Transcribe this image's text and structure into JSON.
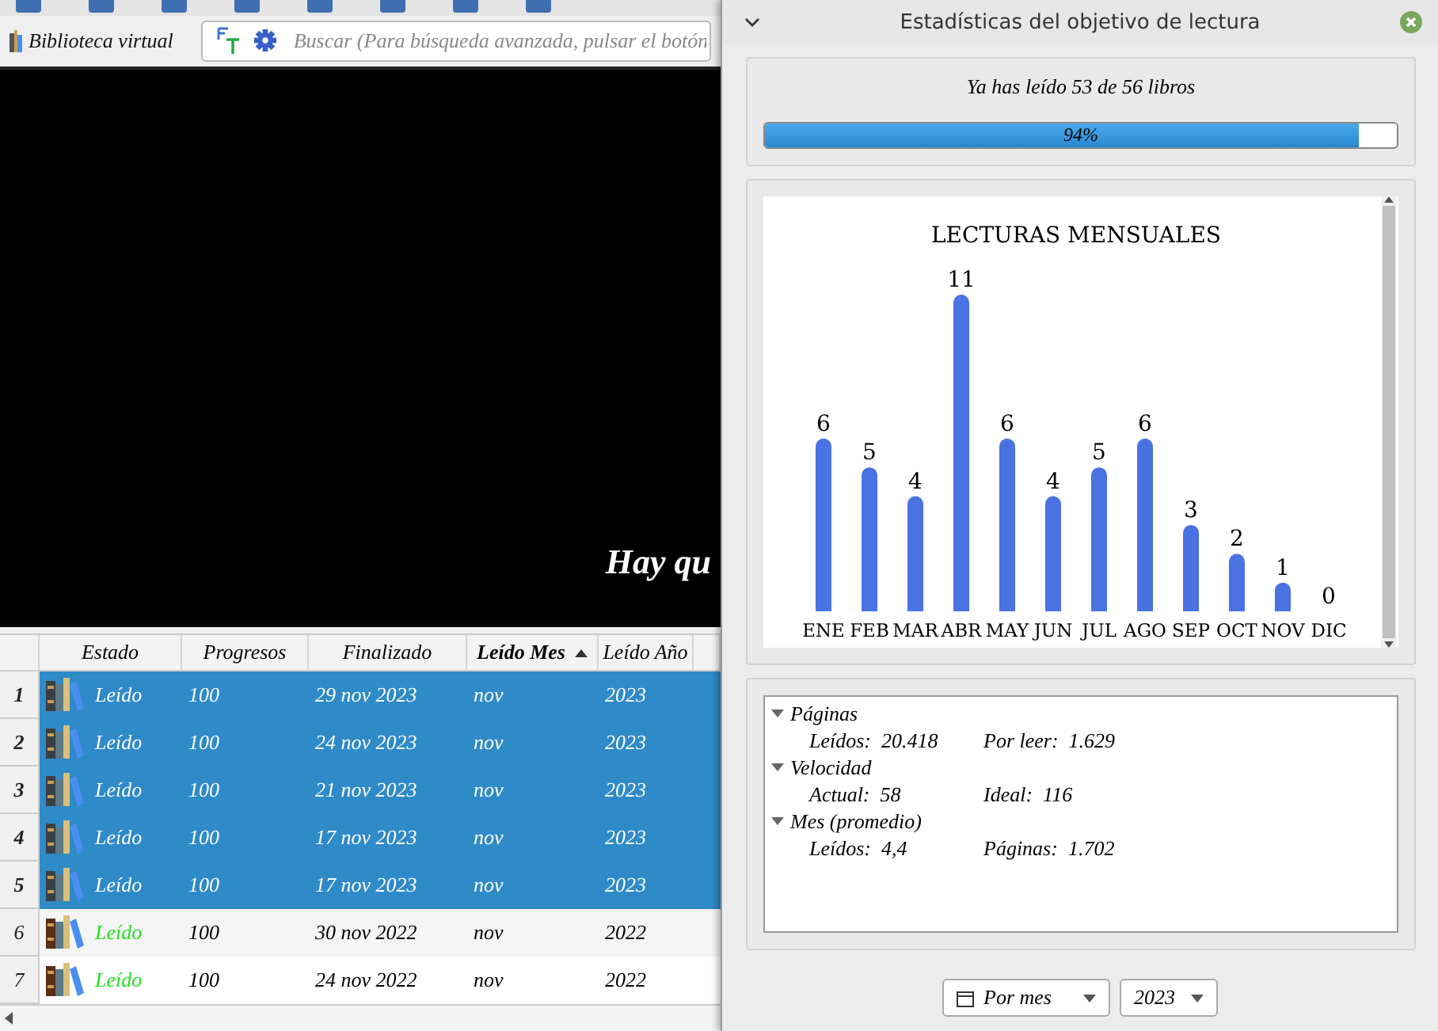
{
  "toolbar": {
    "library_button": "Biblioteca virtual",
    "search": {
      "placeholder": "Buscar (Para búsqueda avanzada, pulsar el botón"
    }
  },
  "cover": {
    "text": "Hay qu"
  },
  "table": {
    "columns": [
      {
        "label": "Estado",
        "sorted": false
      },
      {
        "label": "Progresos",
        "sorted": false
      },
      {
        "label": "Finalizado",
        "sorted": false
      },
      {
        "label": "Leído Mes",
        "sorted": true
      },
      {
        "label": "Leído Año",
        "sorted": false
      }
    ],
    "rows": [
      {
        "number": "1",
        "status": "Leído",
        "progress": "100",
        "finished": "29 nov 2023",
        "month": "nov",
        "year": "2023",
        "selected": true
      },
      {
        "number": "2",
        "status": "Leído",
        "progress": "100",
        "finished": "24 nov 2023",
        "month": "nov",
        "year": "2023",
        "selected": true
      },
      {
        "number": "3",
        "status": "Leído",
        "progress": "100",
        "finished": "21 nov 2023",
        "month": "nov",
        "year": "2023",
        "selected": true
      },
      {
        "number": "4",
        "status": "Leído",
        "progress": "100",
        "finished": "17 nov 2023",
        "month": "nov",
        "year": "2023",
        "selected": true
      },
      {
        "number": "5",
        "status": "Leído",
        "progress": "100",
        "finished": "17 nov 2023",
        "month": "nov",
        "year": "2023",
        "selected": true
      },
      {
        "number": "6",
        "status": "Leído",
        "progress": "100",
        "finished": "30 nov 2022",
        "month": "nov",
        "year": "2022",
        "selected": false
      },
      {
        "number": "7",
        "status": "Leído",
        "progress": "100",
        "finished": "24 nov 2022",
        "month": "nov",
        "year": "2022",
        "selected": false
      }
    ]
  },
  "dialog": {
    "title": "Estadísticas del objetivo de lectura",
    "goal": {
      "text": "Ya has leído 53 de 56 libros",
      "level": 0.94,
      "reading": "94%"
    },
    "chart_data": {
      "type": "bar",
      "title": "LECTURAS MENSUALES",
      "categories": [
        "ENE",
        "FEB",
        "MAR",
        "ABR",
        "MAY",
        "JUN",
        "JUL",
        "AGO",
        "SEP",
        "OCT",
        "NOV",
        "DIC"
      ],
      "values": [
        6,
        5,
        4,
        11,
        6,
        4,
        5,
        6,
        3,
        2,
        1,
        0
      ],
      "data_labels": true
    },
    "stats": [
      {
        "label": "Páginas",
        "expanded": true,
        "children": [
          {
            "label": "Leídos:",
            "value": "20.418"
          },
          {
            "label": "Por leer:",
            "value": "1.629"
          }
        ]
      },
      {
        "label": "Velocidad",
        "expanded": true,
        "children": [
          {
            "label": "Actual:",
            "value": "58"
          },
          {
            "label": "Ideal:",
            "value": "116"
          }
        ]
      },
      {
        "label": "Mes (promedio)",
        "expanded": true,
        "children": [
          {
            "label": "Leídos:",
            "value": "4,4"
          },
          {
            "label": "Páginas:",
            "value": "1.702"
          }
        ]
      }
    ],
    "period_select": "Por mes",
    "year_select": "2023"
  }
}
